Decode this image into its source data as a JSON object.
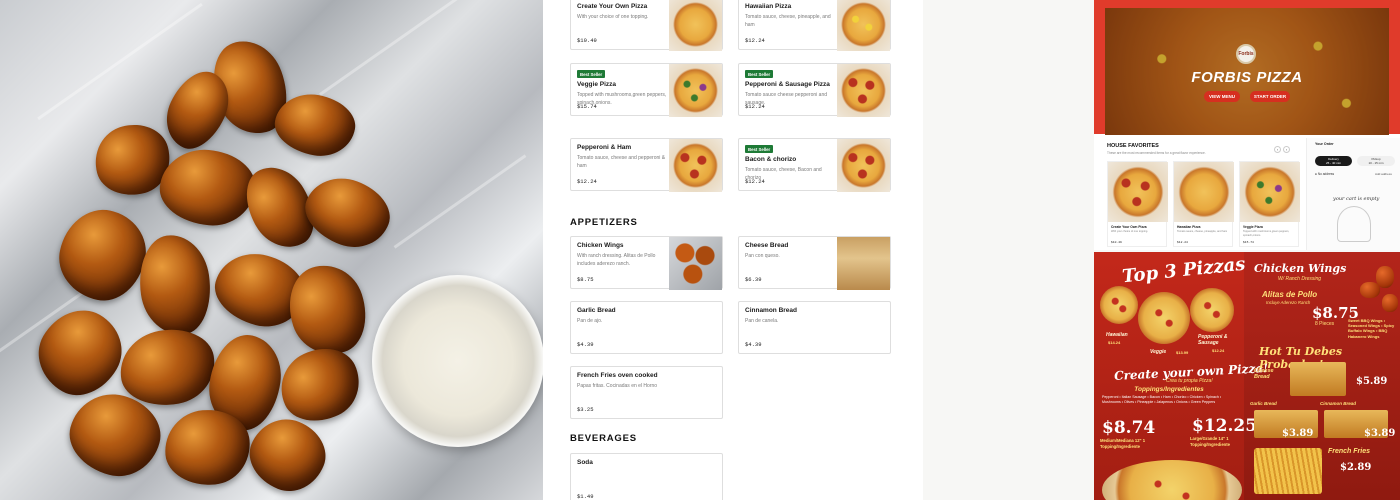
{
  "menu": {
    "sections": {
      "appetizers": "APPETIZERS",
      "beverages": "BEVERAGES"
    },
    "badge_label": "Best Seller",
    "pizzas": [
      {
        "name": "Create Your Own Pizza",
        "desc": "With your choice of one topping.",
        "price": "$10.49",
        "badge": false
      },
      {
        "name": "Hawaiian Pizza",
        "desc": "Tomato sauce, cheese, pineapple, and ham",
        "price": "$12.24",
        "badge": false
      },
      {
        "name": "Veggie Pizza",
        "desc": "Topped with mushrooms,green peppers, spinach,onions.",
        "price": "$15.74",
        "badge": true
      },
      {
        "name": "Pepperoni & Sausage Pizza",
        "desc": "Tomato sauce cheese pepperoni and sausage.",
        "price": "$12.24",
        "badge": true
      },
      {
        "name": "Pepperoni & Ham",
        "desc": "Tomato sauce, cheese and pepperoni & ham",
        "price": "$12.24",
        "badge": false
      },
      {
        "name": "Bacon & chorizo",
        "desc": "Tomato sauce, cheese, Bacon and chorizo",
        "price": "$12.24",
        "badge": true
      }
    ],
    "appetizers": [
      {
        "name": "Chicken Wings",
        "desc": "With ranch dressing. Alitas de Pollo includes aderezo ranch.",
        "price": "$8.75"
      },
      {
        "name": "Cheese Bread",
        "desc": "Pan con queso.",
        "price": "$6.39"
      },
      {
        "name": "Garlic Bread",
        "desc": "Pan de ajo.",
        "price": "$4.39"
      },
      {
        "name": "Cinnamon Bread",
        "desc": "Pan de canela.",
        "price": "$4.39"
      },
      {
        "name": "French Fries oven cooked",
        "desc": "Papas fritas. Cocinadas en el Horno",
        "price": "$3.25"
      }
    ],
    "beverages": [
      {
        "name": "Soda",
        "desc": "",
        "price": "$1.49"
      }
    ]
  },
  "website": {
    "logo_text": "Forbis",
    "brand": "FORBIS PIZZA",
    "view_menu": "VIEW MENU",
    "start_order": "START ORDER",
    "house_title": "HOUSE FAVORITES",
    "house_sub": "These are the most recommended items for a great flavor experience.",
    "prev_icon": "chevron-left-icon",
    "next_icon": "chevron-right-icon",
    "favorites": [
      {
        "name": "Create Your Own Pizza",
        "desc": "With your choice of one topping.",
        "price": "$10.49"
      },
      {
        "name": "Hawaiian Pizza",
        "desc": "Tomato sauce, cheese, pineapple, and ham",
        "price": "$12.24"
      },
      {
        "name": "Veggie Pizza",
        "desc": "Topped with mushrooms,green peppers, spinach,onions.",
        "price": "$15.74"
      }
    ],
    "order": {
      "title": "Your Order",
      "delivery": "Delivery",
      "delivery_sub": "25 - 40 min",
      "pickup": "Pickup",
      "pickup_sub": "10 - 15 min",
      "no_address": "No address",
      "add_address": "Add address",
      "empty_cart": "your cart is empty"
    }
  },
  "flyer": {
    "title": "Top 3 Pizzas",
    "pizzas": [
      {
        "name": "Hawaiian",
        "price": "$14.24"
      },
      {
        "name": "Veggie",
        "price": "$13.99"
      },
      {
        "name": "Pepperoni & Sausage",
        "price": "$12.24"
      }
    ],
    "create": "Create your own Pizza!",
    "create_sub": "Crea tu propia Pizza!",
    "toppings_title": "Toppings/Ingredientes",
    "toppings": "Pepperoni • Italian Sausage • Bacon • Ham • Chorizo • Chicken • Spinach • Mushrooms • Olives • Pineapple • Jalapenos • Onions • Green Peppers",
    "medium_price": "$8.74",
    "medium_label": "Medium/Mediana 12\" 1 Topping/Ingrediente",
    "large_price": "$12.25",
    "large_label": "Large/Grande 14\" 1 Topping/Ingrediente",
    "wings_title": "Chicken Wings",
    "wings_sub": "W/ Ranch Dressing",
    "alitas": "Alitas de Pollo",
    "alitas_sub": "Incluye Aderezo Ranch",
    "wings_price": "$8.75",
    "wings_pcs": "8 Pieces",
    "flavors": "Sweet BBQ Wings • Seasoned Wings • Spicy Buffalo Wings • BBQ Habanero Wings",
    "hot_title": "Hot Tu Debes Probarlas!",
    "cheese_bread": "Cheese Bread",
    "cheese_price": "$5.89",
    "garlic_bread": "Garlic Bread",
    "cinnamon_bread": "Cinnamon Bread",
    "bread_price_1": "$3.89",
    "bread_price_2": "$3.89",
    "fries": "French Fries",
    "fries_price": "$2.89"
  },
  "colors": {
    "badge_green": "#1e7a36",
    "brand_red": "#e03b2b",
    "flyer_yellow": "#ffe17a"
  }
}
